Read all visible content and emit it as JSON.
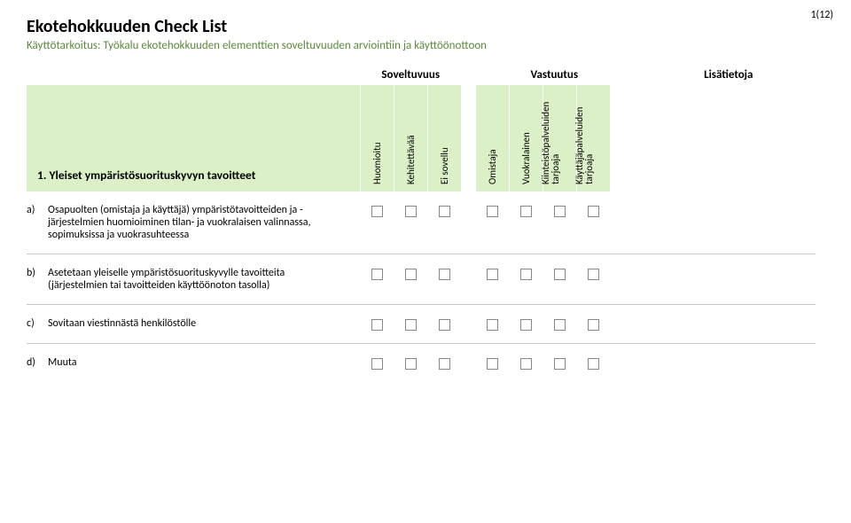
{
  "page_number": "1(12)",
  "title": "Ekotehokkuuden Check List",
  "subtitle": "Käyttötarkoitus: Työkalu ekotehokkuuden elementtien soveltuvuuden arviointiin ja käyttöönottoon",
  "group_headers": {
    "g1": "Soveltuvuus",
    "g2": "Vastuutus",
    "g3": "Lisätietoja"
  },
  "section_title": "1. Yleiset ympäristösuorituskyvyn tavoitteet",
  "columns": {
    "c1": "Huomioitu",
    "c2": "Kehitettävää",
    "c3": "Ei sovellu",
    "c4": "Omistaja",
    "c5": "Vuokralainen",
    "c6_l1": "Kiinteistöpalveluiden",
    "c6_l2": "tarjoaja",
    "c7_l1": "Käyttäjäpalveluiden",
    "c7_l2": "tarjoaja"
  },
  "rows": [
    {
      "letter": "a)",
      "text": "Osapuolten (omistaja ja käyttäjä) ympäristötavoitteiden ja -järjestelmien huomioiminen tilan- ja vuokralaisen valinnassa, sopimuksissa ja vuokrasuhteessa"
    },
    {
      "letter": "b)",
      "text": "Asetetaan yleiselle ympäristösuorituskyvylle tavoitteita (järjestelmien tai tavoitteiden käyttöönoton tasolla)"
    },
    {
      "letter": "c)",
      "text": "Sovitaan viestinnästä henkilöstölle"
    },
    {
      "letter": "d)",
      "text": "Muuta"
    }
  ]
}
